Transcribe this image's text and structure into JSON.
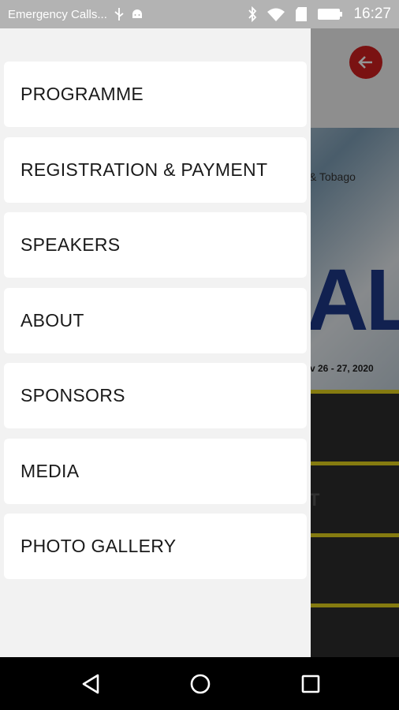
{
  "status_bar": {
    "carrier_text": "Emergency Calls...",
    "time": "16:27",
    "icons": [
      "usb-icon",
      "android-debug-icon",
      "bluetooth-icon",
      "wifi-icon",
      "sim-icon",
      "battery-icon"
    ]
  },
  "background": {
    "banner_country": "& Tobago",
    "banner_big": "AL",
    "banner_date": "v 26 - 27, 2020",
    "menu_partial_text": "T"
  },
  "drawer": {
    "items": [
      {
        "label": "PROGRAMME"
      },
      {
        "label": "REGISTRATION & PAYMENT"
      },
      {
        "label": "SPEAKERS"
      },
      {
        "label": "ABOUT"
      },
      {
        "label": "SPONSORS"
      },
      {
        "label": "MEDIA"
      },
      {
        "label": "PHOTO GALLERY"
      }
    ]
  },
  "colors": {
    "back_button": "#d21f1f",
    "accent_line": "#e6d51c",
    "drawer_bg": "#f2f2f2"
  }
}
